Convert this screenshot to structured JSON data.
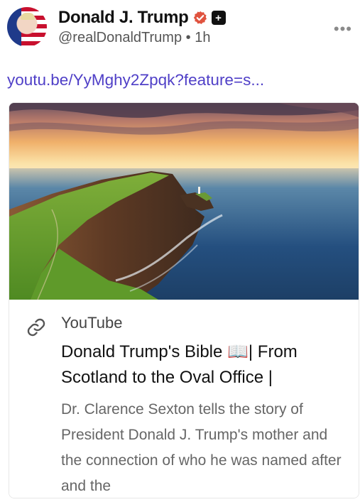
{
  "post": {
    "display_name": "Donald J. Trump",
    "handle": "@realDonaldTrump",
    "separator": "•",
    "time": "1h",
    "more": "•••",
    "link_text": "youtu.be/YyMghy2Zpqk?feature=s..."
  },
  "icons": {
    "verified": "verified-badge-icon",
    "plus": "plus-square-icon",
    "more": "more-horizontal-icon",
    "link": "link-chain-icon"
  },
  "colors": {
    "link": "#4f3fc7",
    "verified": "#e0533f"
  },
  "card": {
    "source": "YouTube",
    "title": "Donald Trump's Bible 📖| From Scotland to the Oval Office |",
    "description": "Dr. Clarence Sexton tells the story of President Donald J. Trump's mother and the connection of who he was named after and the"
  }
}
